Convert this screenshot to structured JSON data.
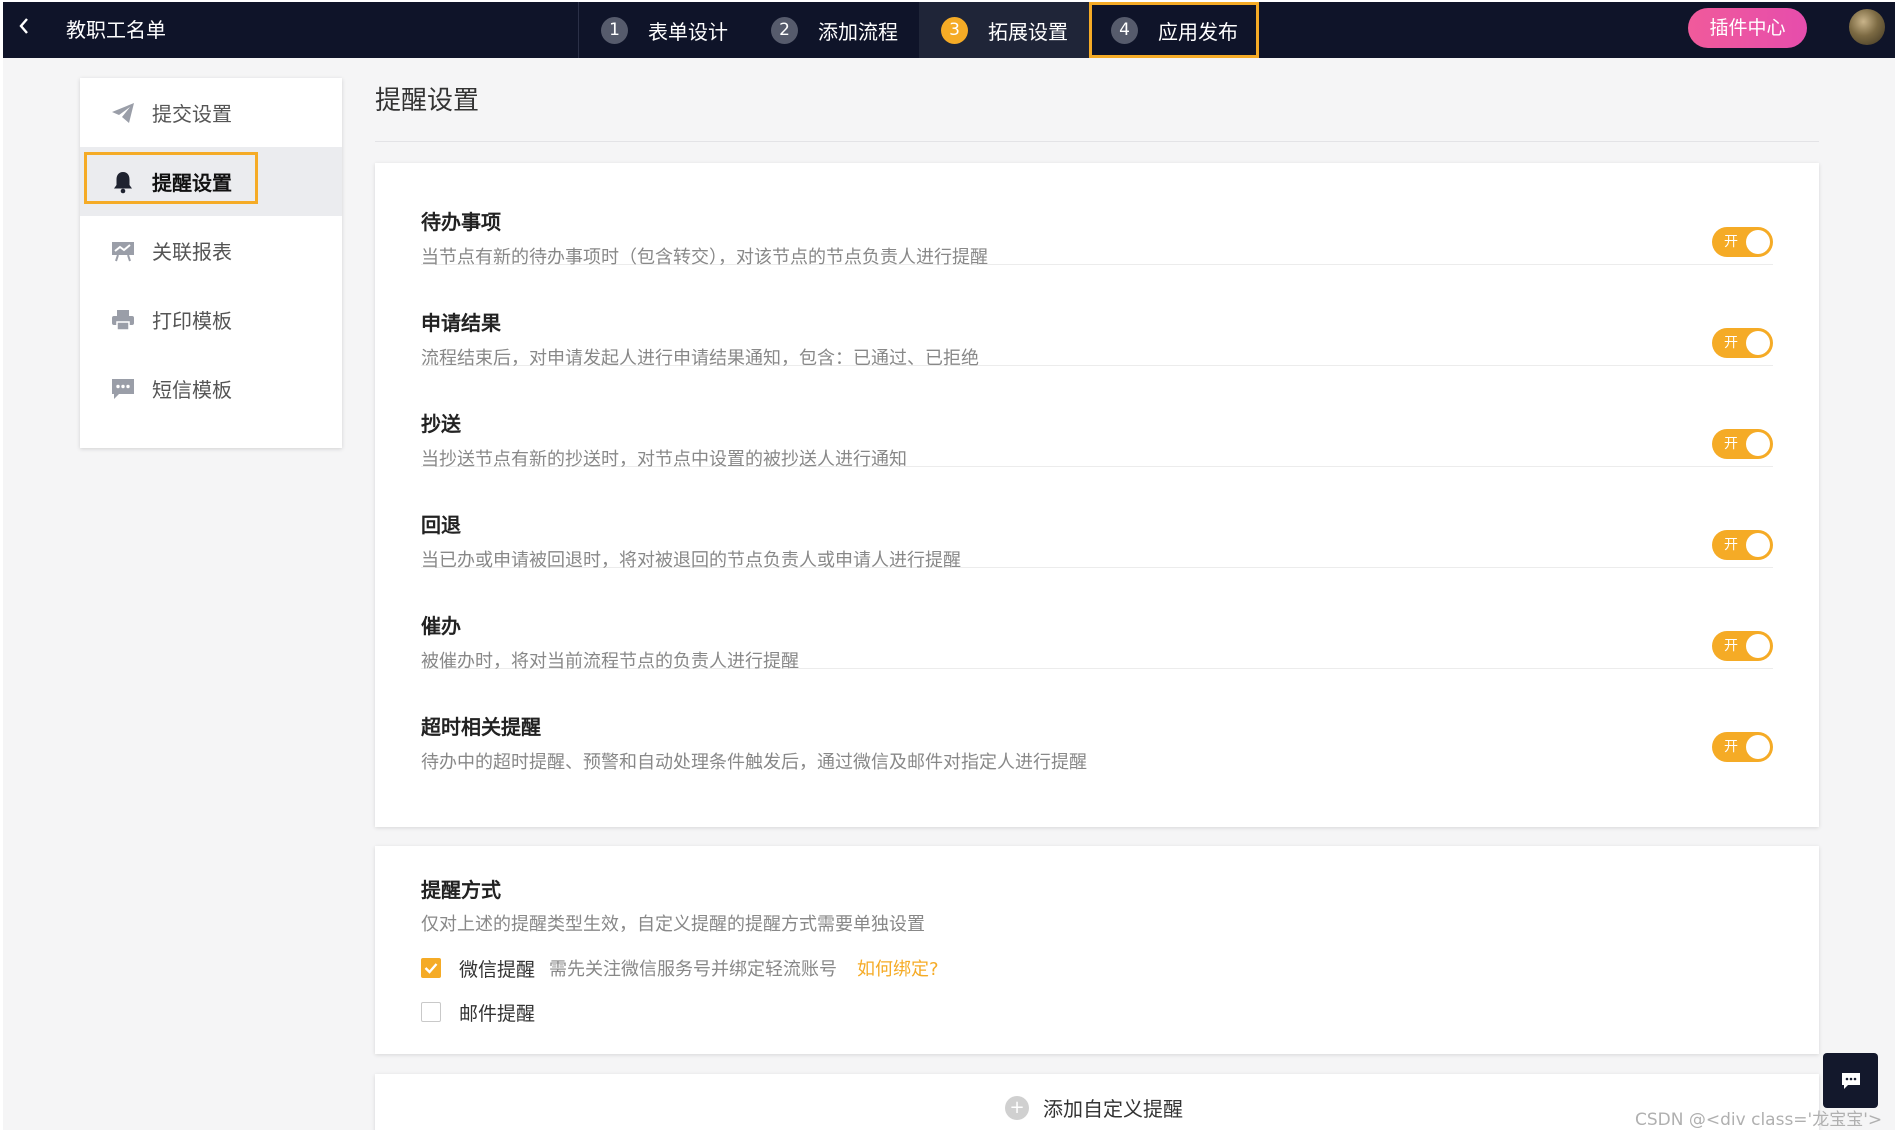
{
  "app": {
    "title": "教职工名单"
  },
  "steps": [
    {
      "num": "1",
      "label": "表单设计"
    },
    {
      "num": "2",
      "label": "添加流程"
    },
    {
      "num": "3",
      "label": "拓展设置"
    },
    {
      "num": "4",
      "label": "应用发布"
    }
  ],
  "header": {
    "plugin_label": "插件中心"
  },
  "sidebar": {
    "items": [
      {
        "label": "提交设置",
        "icon": "send-icon"
      },
      {
        "label": "提醒设置",
        "icon": "bell-icon"
      },
      {
        "label": "关联报表",
        "icon": "report-icon"
      },
      {
        "label": "打印模板",
        "icon": "printer-icon"
      },
      {
        "label": "短信模板",
        "icon": "sms-icon"
      }
    ]
  },
  "main": {
    "title": "提醒设置",
    "reminders": [
      {
        "title": "待办事项",
        "desc": "当节点有新的待办事项时（包含转交），对该节点的节点负责人进行提醒",
        "toggle": "开"
      },
      {
        "title": "申请结果",
        "desc": "流程结束后，对申请发起人进行申请结果通知，包含：已通过、已拒绝",
        "toggle": "开"
      },
      {
        "title": "抄送",
        "desc": "当抄送节点有新的抄送时，对节点中设置的被抄送人进行通知",
        "toggle": "开"
      },
      {
        "title": "回退",
        "desc": "当已办或申请被回退时，将对被退回的节点负责人或申请人进行提醒",
        "toggle": "开"
      },
      {
        "title": "催办",
        "desc": "被催办时，将对当前流程节点的负责人进行提醒",
        "toggle": "开"
      },
      {
        "title": "超时相关提醒",
        "desc": "待办中的超时提醒、预警和自动处理条件触发后，通过微信及邮件对指定人进行提醒",
        "toggle": "开"
      }
    ],
    "method": {
      "title": "提醒方式",
      "desc": "仅对上述的提醒类型生效，自定义提醒的提醒方式需要单独设置",
      "wechat": {
        "label": "微信提醒",
        "note": "需先关注微信服务号并绑定轻流账号",
        "link": "如何绑定?",
        "checked": true
      },
      "email": {
        "label": "邮件提醒",
        "checked": false
      }
    },
    "add_custom_label": "添加自定义提醒"
  },
  "colors": {
    "accent": "#f5ab26",
    "topbar": "#0f1429",
    "plugin": "#e64dac"
  },
  "watermark": "CSDN @<div class='龙宝宝'>"
}
